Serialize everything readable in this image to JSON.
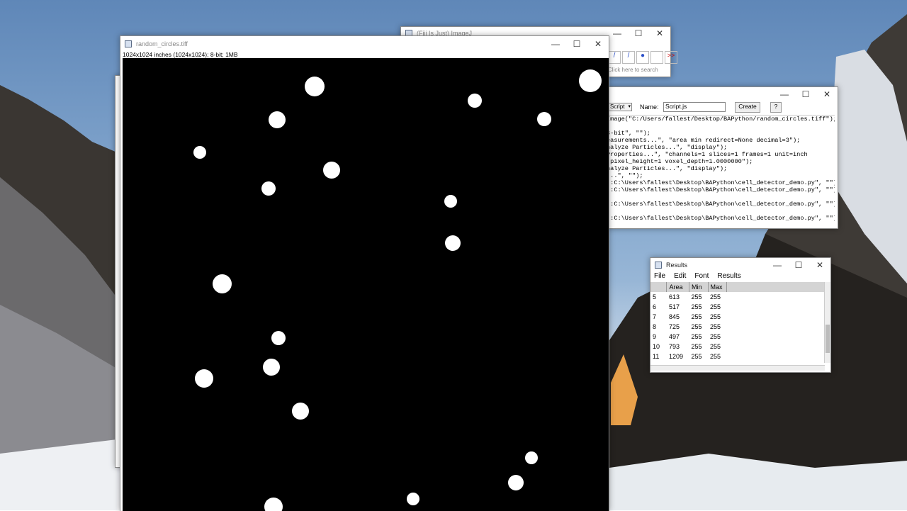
{
  "image_window": {
    "title": "random_circles.tiff",
    "info": "1024x1024 inches (1024x1024); 8-bit; 1MB"
  },
  "imagej_window": {
    "title": "(Fiji Is Just) ImageJ",
    "search_placeholder": "Click here to search",
    "more_tools": ">>"
  },
  "script_editor": {
    "language": "Script",
    "name_label": "Name:",
    "name_value": "Script.js",
    "create_label": "Create",
    "help_label": "?",
    "lines": [
      "Image(\"C:/Users/fallest/Desktop/BAPython/random_circles.tiff\");",
      "",
      "3-bit\", \"\");",
      "easurements...\", \"area min redirect=None decimal=3\");",
      "nalyze Particles...\", \"display\");",
      "Properties...\", \"channels=1 slices=1 frames=1 unit=inch",
      " pixel_height=1 voxel_depth=1.0000000\");",
      "nalyze Particles...\", \"display\");",
      "...\", \"\");",
      "::C:\\Users\\fallest\\Desktop\\BAPython\\cell_detector_demo.py\", \"\");",
      "::C:\\Users\\fallest\\Desktop\\BAPython\\cell_detector_demo.py\", \"\");",
      "",
      "::C:\\Users\\fallest\\Desktop\\BAPython\\cell_detector_demo.py\", \"\");",
      "",
      "::C:\\Users\\fallest\\Desktop\\BAPython\\cell_detector_demo.py\", \"\");"
    ]
  },
  "results_window": {
    "title": "Results",
    "menu": [
      "File",
      "Edit",
      "Font",
      "Results"
    ],
    "columns": [
      "",
      "Area",
      "Min",
      "Max"
    ],
    "rows": [
      [
        "5",
        "613",
        "255",
        "255"
      ],
      [
        "6",
        "517",
        "255",
        "255"
      ],
      [
        "7",
        "845",
        "255",
        "255"
      ],
      [
        "8",
        "725",
        "255",
        "255"
      ],
      [
        "9",
        "497",
        "255",
        "255"
      ],
      [
        "10",
        "793",
        "255",
        "255"
      ],
      [
        "11",
        "1209",
        "255",
        "255"
      ]
    ]
  },
  "window_controls": {
    "minimize": "—",
    "maximize": "☐",
    "close": "✕"
  },
  "colors": {
    "image_bg": "#000000",
    "particle": "#ffffff",
    "sky": "#86a9cf"
  }
}
